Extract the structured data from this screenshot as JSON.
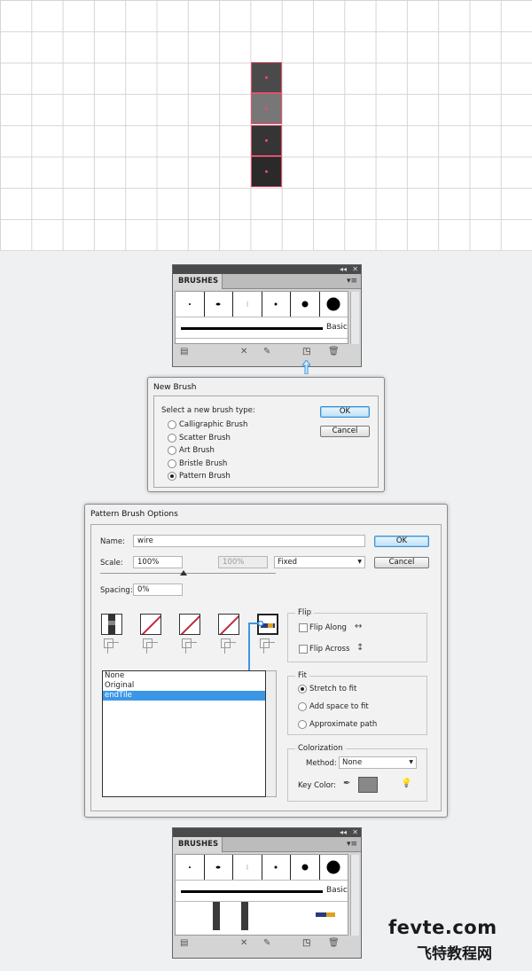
{
  "brushes_panel": {
    "tab_label": "BRUSHES",
    "basic_label": "Basic",
    "collapse_glyph": "◂◂",
    "close_glyph": "✕",
    "menu_glyph": "▾≡",
    "icons": [
      "brush-libraries-icon",
      "remove-stroke-icon",
      "brush-options-icon",
      "new-brush-icon",
      "delete-brush-icon"
    ]
  },
  "new_brush_dialog": {
    "title": "New Brush",
    "prompt": "Select a new brush type:",
    "options": [
      "Calligraphic Brush",
      "Scatter Brush",
      "Art Brush",
      "Bristle Brush",
      "Pattern Brush"
    ],
    "selected": "Pattern Brush",
    "ok_label": "OK",
    "cancel_label": "Cancel"
  },
  "pattern_dialog": {
    "title": "Pattern Brush Options",
    "name_label": "Name:",
    "name_value": "wire",
    "scale_label": "Scale:",
    "scale_value": "100%",
    "scale_value2": "100%",
    "scale_mode": "Fixed",
    "spacing_label": "Spacing:",
    "spacing_value": "0%",
    "ok_label": "OK",
    "cancel_label": "Cancel",
    "tile_list": [
      "None",
      "Original",
      "endTile"
    ],
    "selected_tile": "endTile",
    "flip": {
      "title": "Flip",
      "along": "Flip Along",
      "across": "Flip Across"
    },
    "fit": {
      "title": "Fit",
      "options": [
        "Stretch to fit",
        "Add space to fit",
        "Approximate path"
      ],
      "selected": "Stretch to fit"
    },
    "colorization": {
      "title": "Colorization",
      "method_label": "Method:",
      "method_value": "None",
      "key_color_label": "Key Color:",
      "key_color": "#888888"
    }
  },
  "watermark": {
    "site": "fevte.com",
    "cn": "飞特教程网"
  },
  "colors": {
    "anchor": "#e2516a",
    "select": "#3b97e6",
    "panel_dark": "#4a4a4a"
  }
}
